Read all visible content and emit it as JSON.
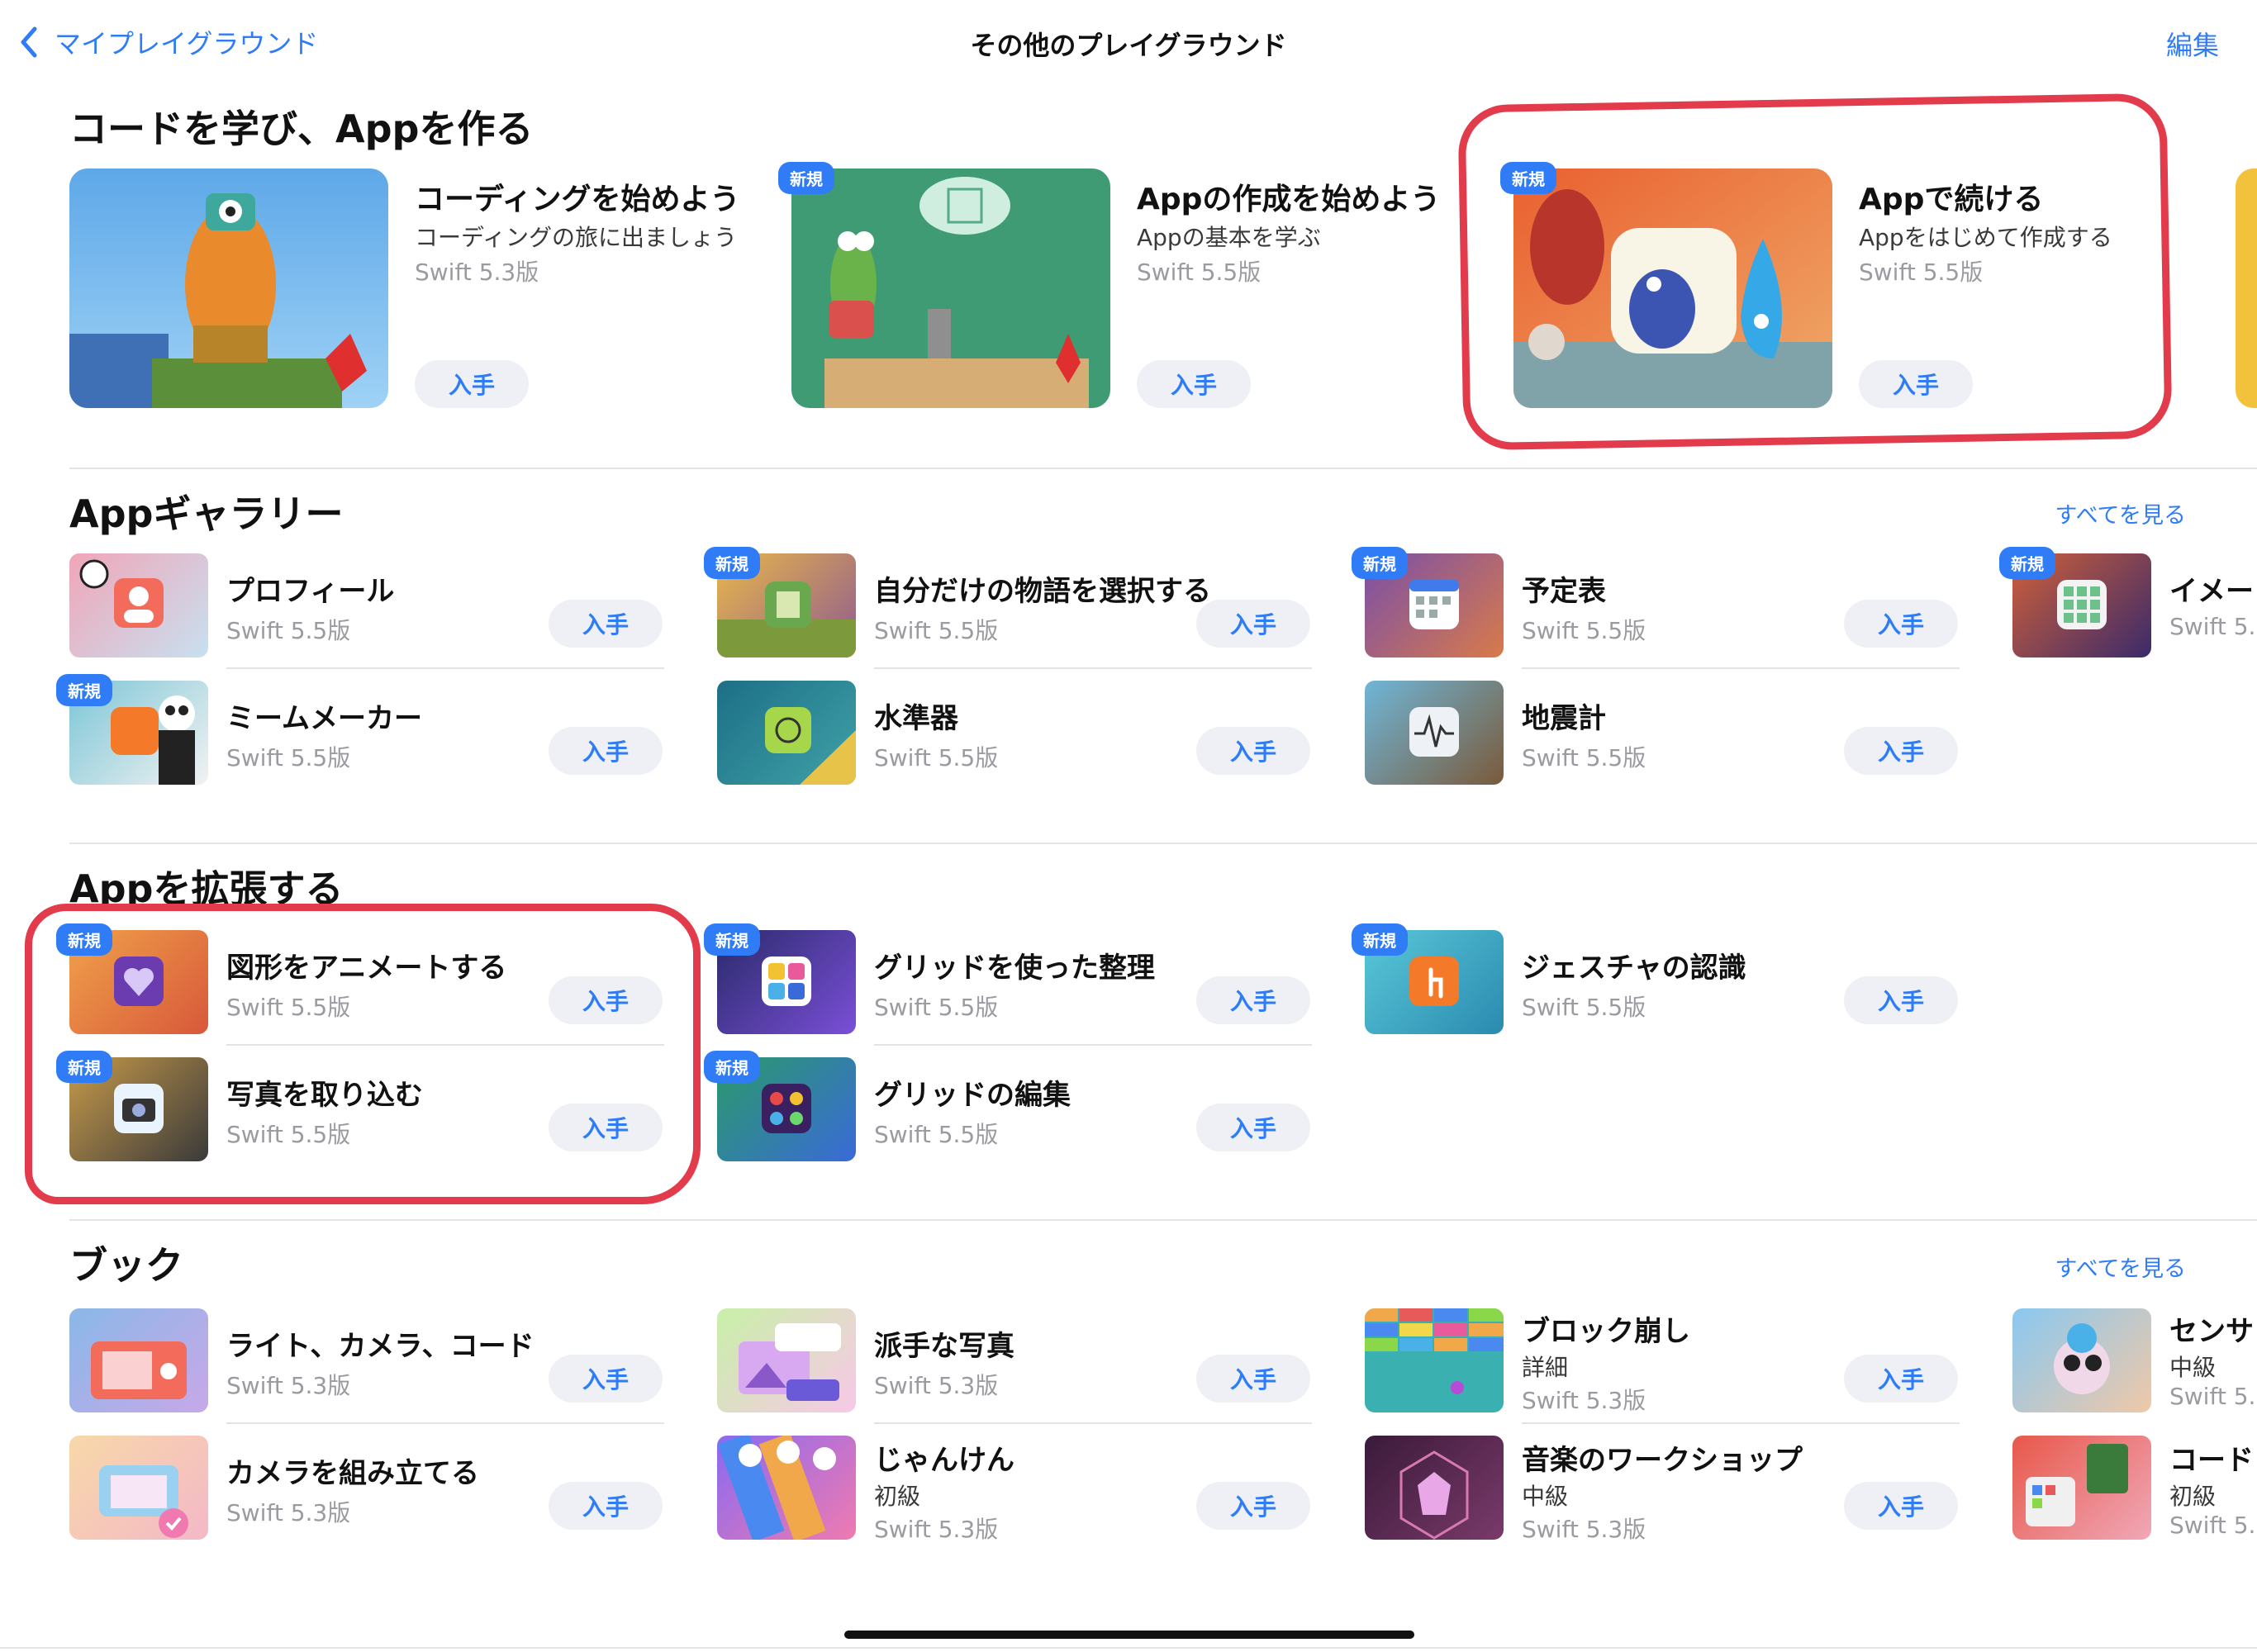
{
  "nav": {
    "back_label": "マイプレイグラウンド",
    "title": "その他のプレイグラウンド",
    "edit_label": "編集"
  },
  "sections": {
    "learn": {
      "title": "コードを学び、Appを作る",
      "cards": [
        {
          "title": "コーディングを始めよう",
          "subtitle": "コーディングの旅に出ましょう",
          "version": "Swift 5.3版",
          "button": "入手",
          "badge": ""
        },
        {
          "title": "Appの作成を始めよう",
          "subtitle": "Appの基本を学ぶ",
          "version": "Swift 5.5版",
          "button": "入手",
          "badge": "新規"
        },
        {
          "title": "Appで続ける",
          "subtitle": "Appをはじめて作成する",
          "version": "Swift 5.5版",
          "button": "入手",
          "badge": "新規"
        }
      ]
    },
    "gallery": {
      "title": "Appギャラリー",
      "see_all": "すべてを見る",
      "items": [
        {
          "title": "プロフィール",
          "version": "Swift 5.5版",
          "button": "入手",
          "badge": ""
        },
        {
          "title": "ミームメーカー",
          "version": "Swift 5.5版",
          "button": "入手",
          "badge": "新規"
        },
        {
          "title": "自分だけの物語を選択する",
          "version": "Swift 5.5版",
          "button": "入手",
          "badge": "新規"
        },
        {
          "title": "水準器",
          "version": "Swift 5.5版",
          "button": "入手",
          "badge": ""
        },
        {
          "title": "予定表",
          "version": "Swift 5.5版",
          "button": "入手",
          "badge": "新規"
        },
        {
          "title": "地震計",
          "version": "Swift 5.5版",
          "button": "入手",
          "badge": ""
        },
        {
          "title": "イメー",
          "version": "Swift 5.",
          "badge": "新規"
        }
      ]
    },
    "extend": {
      "title": "Appを拡張する",
      "items": [
        {
          "title": "図形をアニメートする",
          "version": "Swift 5.5版",
          "button": "入手",
          "badge": "新規"
        },
        {
          "title": "写真を取り込む",
          "version": "Swift 5.5版",
          "button": "入手",
          "badge": "新規"
        },
        {
          "title": "グリッドを使った整理",
          "version": "Swift 5.5版",
          "button": "入手",
          "badge": "新規"
        },
        {
          "title": "グリッドの編集",
          "version": "Swift 5.5版",
          "button": "入手",
          "badge": "新規"
        },
        {
          "title": "ジェスチャの認識",
          "version": "Swift 5.5版",
          "button": "入手",
          "badge": "新規"
        }
      ]
    },
    "books": {
      "title": "ブック",
      "see_all": "すべてを見る",
      "items": [
        {
          "title": "ライト、カメラ、コード",
          "version": "Swift 5.3版",
          "button": "入手"
        },
        {
          "title": "カメラを組み立てる",
          "version": "Swift 5.3版",
          "button": "入手"
        },
        {
          "title": "派手な写真",
          "version": "Swift 5.3版",
          "button": "入手"
        },
        {
          "title": "じゃんけん",
          "level": "初級",
          "version": "Swift 5.3版",
          "button": "入手"
        },
        {
          "title": "ブロック崩し",
          "level": "詳細",
          "version": "Swift 5.3版",
          "button": "入手"
        },
        {
          "title": "音楽のワークショップ",
          "level": "中級",
          "version": "Swift 5.3版",
          "button": "入手"
        },
        {
          "title": "センサ",
          "level": "中級",
          "version": "Swift 5."
        },
        {
          "title": "コード",
          "level": "初級",
          "version": "Swift 5."
        }
      ]
    }
  },
  "colors": {
    "accent": "#2f7cf6",
    "annotation": "#e23b4b",
    "button_bg": "#eef0f5"
  }
}
